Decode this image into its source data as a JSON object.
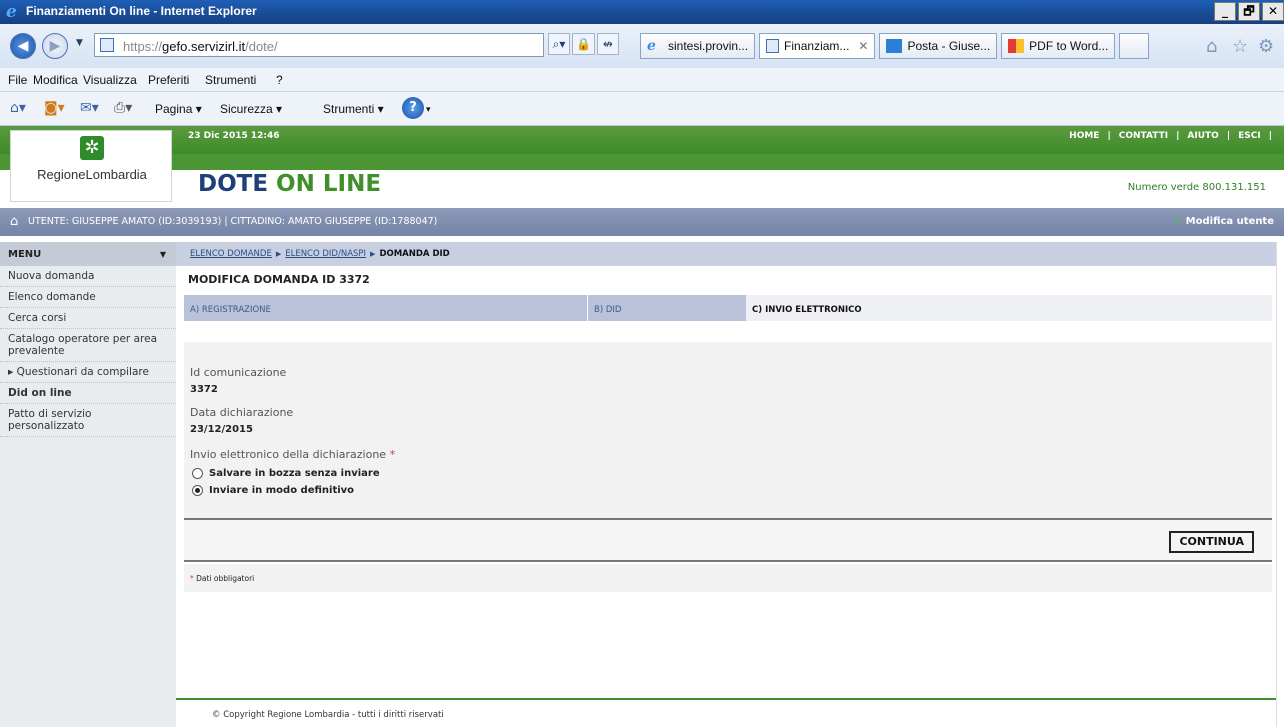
{
  "window": {
    "title": "Finanziamenti On line - Internet Explorer",
    "controls": [
      "_",
      "🗗",
      "✕"
    ]
  },
  "address_bar": {
    "url_prefix": "https://",
    "url_host": "gefo.servizirl.it",
    "url_path": "/dote/"
  },
  "browser_tabs": [
    {
      "label": "sintesi.provin...",
      "icon": "ie-icon"
    },
    {
      "label": "Finanziam...",
      "icon": "page-icon",
      "close": "✕"
    },
    {
      "label": "Posta - Giuse...",
      "icon": "mail-icon"
    },
    {
      "label": "PDF to Word...",
      "icon": "pdf-app-icon"
    }
  ],
  "menubar": [
    "File",
    "Modifica",
    "Visualizza",
    "Preferiti",
    "Strumenti",
    "?"
  ],
  "commandbar": {
    "pagina": "Pagina ▾",
    "sicurezza": "Sicurezza ▾",
    "strumenti": "Strumenti ▾"
  },
  "site": {
    "date": "23 Dic 2015 12:46",
    "links": [
      "HOME",
      "|",
      "CONTATTI",
      "|",
      "AIUTO",
      "|",
      "ESCI",
      "|"
    ],
    "logo_text": "RegioneLombardia",
    "brand_part1": "DOTE",
    "brand_part2": " ON LINE",
    "numero_verde": "Numero verde 800.131.151",
    "user_line": "UTENTE: GIUSEPPE AMATO (ID:3039193)  |  CITTADINO: AMATO GIUSEPPE (ID:1788047)",
    "modifica_utente": "Modifica utente"
  },
  "sidebar": {
    "header": "MENU",
    "items": [
      {
        "label": "Nuova domanda"
      },
      {
        "label": "Elenco domande"
      },
      {
        "label": "Cerca corsi"
      },
      {
        "label": "Catalogo operatore per area prevalente"
      },
      {
        "label": "▸ Questionari da compilare"
      },
      {
        "label": "Did on line"
      },
      {
        "label": "Patto di servizio personalizzato"
      }
    ]
  },
  "breadcrumb": {
    "link1": "ELENCO DOMANDE",
    "link2": "ELENCO DID/NASPI",
    "current": "DOMANDA DID"
  },
  "main": {
    "title": "MODIFICA DOMANDA ID 3372",
    "steps": [
      "A) REGISTRAZIONE",
      "B) DID",
      "C) INVIO ELETTRONICO"
    ],
    "id_label": "Id comunicazione",
    "id_value": "3372",
    "data_label": "Data dichiarazione",
    "data_value": "23/12/2015",
    "invio_label": "Invio elettronico della dichiarazione",
    "required_mark": "*",
    "option1": "Salvare in bozza senza inviare",
    "option2": "Inviare in modo definitivo",
    "selected_option": 2,
    "continua": "CONTINUA",
    "legend": "Dati obbligatori"
  },
  "footer": "© Copyright Regione Lombardia - tutti i diritti riservati"
}
